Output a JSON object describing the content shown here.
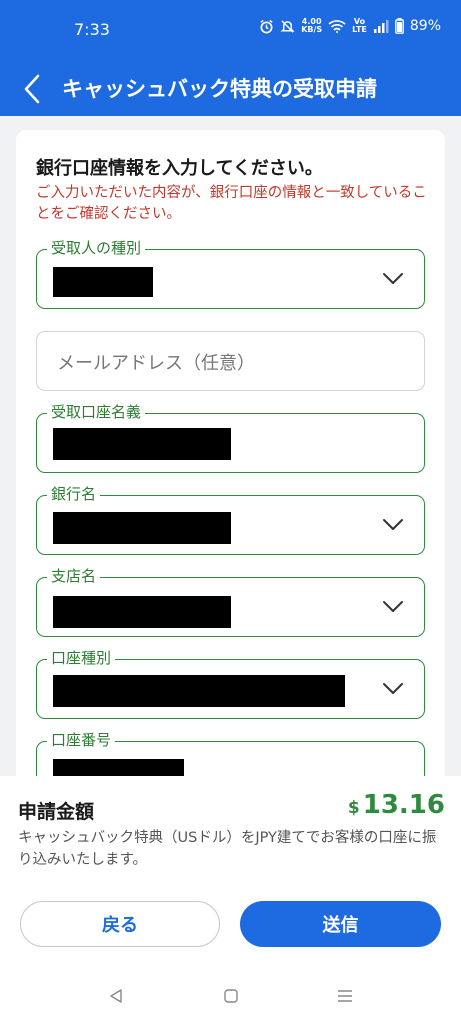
{
  "status_bar": {
    "time": "7:33",
    "net_speed_top": "4.00",
    "net_speed_bottom": "KB/S",
    "volte_top": "Vo",
    "volte_bottom": "LTE",
    "battery": "89%"
  },
  "header": {
    "title": "キャッシュバック特典の受取申請"
  },
  "form": {
    "heading": "銀行口座情報を入力してください。",
    "warning": "ご入力いただいた内容が、銀行口座の情報と一致していることをご確認ください。",
    "fields": [
      {
        "label": "受取人の種別",
        "type": "select"
      },
      {
        "label": "",
        "placeholder": "メールアドレス（任意）",
        "type": "text"
      },
      {
        "label": "受取口座名義",
        "type": "text"
      },
      {
        "label": "銀行名",
        "type": "select"
      },
      {
        "label": "支店名",
        "type": "select"
      },
      {
        "label": "口座種別",
        "type": "select"
      },
      {
        "label": "口座番号",
        "type": "text"
      }
    ]
  },
  "summary": {
    "amount_label": "申請金額",
    "currency_symbol": "$",
    "amount": "13.16",
    "note": "キャッシュバック特典（USドル）をJPY建てでお客様の口座に振り込みいたします。"
  },
  "buttons": {
    "back": "戻る",
    "submit": "送信"
  },
  "colors": {
    "primary": "#1e6ae0",
    "field_border": "#2e8b3e",
    "warning": "#c0392b",
    "amount": "#2e8b3e"
  }
}
